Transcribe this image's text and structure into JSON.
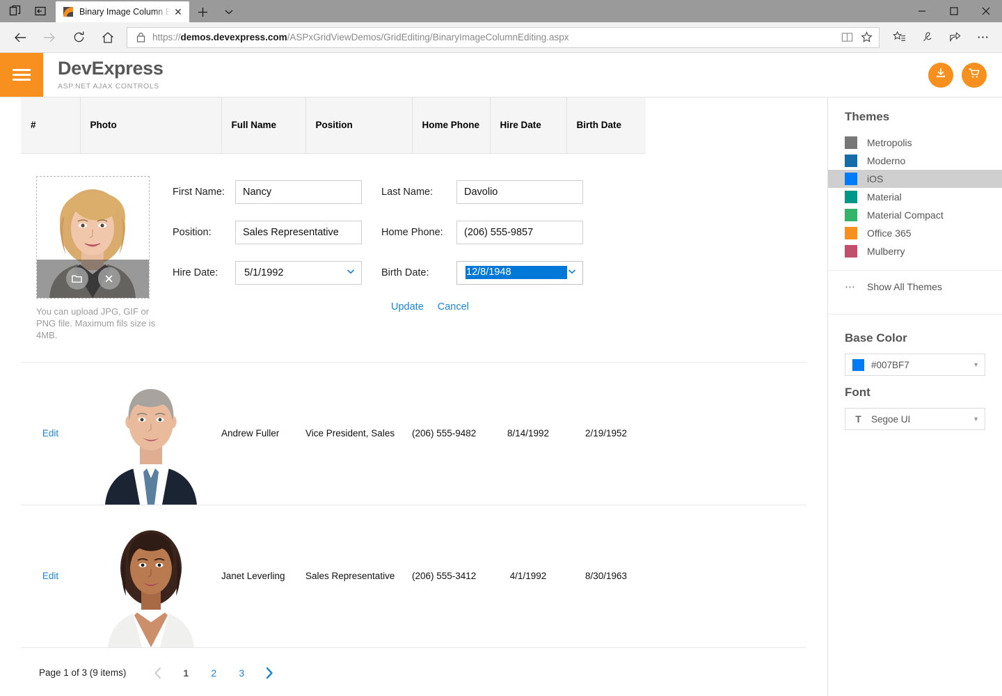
{
  "browser": {
    "tab": {
      "title": "Binary Image Column Editing",
      "favicon": "devexpress-logo-icon",
      "close_label": "✕"
    },
    "new_tab_label": "+",
    "tab_menu_label": "⌄",
    "window_controls": {
      "minimize": "—",
      "maximize": "□",
      "close": "✕"
    },
    "nav": {
      "back": "←",
      "forward": "→",
      "refresh": "⟳",
      "home": "home-icon"
    },
    "url": {
      "scheme": "https://",
      "domain": "demos.devexpress.com",
      "path": "/ASPxGridViewDemos/GridEditing/BinaryImageColumnEditing.aspx",
      "lock": "lock-icon"
    },
    "url_icons": {
      "reading_view": "book-icon",
      "favorite": "☆"
    },
    "toolbar_icons": {
      "favorites": "favorites-icon",
      "notes": "notes-icon",
      "share": "share-icon",
      "more": "•••"
    }
  },
  "app_header": {
    "menu_label": "hamburger-menu",
    "brand": "DevExpress",
    "subtitle": "ASP.NET AJAX CONTROLS",
    "actions": {
      "download": "download-icon",
      "cart": "cart-icon"
    },
    "accent": "#f7901e"
  },
  "grid": {
    "columns": [
      {
        "key": "num",
        "label": "#"
      },
      {
        "key": "photo",
        "label": "Photo"
      },
      {
        "key": "name",
        "label": "Full Name"
      },
      {
        "key": "pos",
        "label": "Position"
      },
      {
        "key": "phone",
        "label": "Home Phone"
      },
      {
        "key": "hire",
        "label": "Hire Date"
      },
      {
        "key": "birth",
        "label": "Birth Date"
      }
    ],
    "edit_form": {
      "upload": {
        "hint": "You can upload JPG, GIF or PNG file. Maximum fils size is 4MB.",
        "browse_icon": "folder-icon",
        "clear_icon": "close-circle-icon"
      },
      "first_name": {
        "label": "First Name:",
        "value": "Nancy"
      },
      "last_name": {
        "label": "Last Name:",
        "value": "Davolio"
      },
      "position": {
        "label": "Position:",
        "value": "Sales Representative"
      },
      "home_phone": {
        "label": "Home Phone:",
        "value": "(206) 555-9857"
      },
      "hire_date": {
        "label": "Hire Date:",
        "value": "5/1/1992"
      },
      "birth_date": {
        "label": "Birth Date:",
        "value": "12/8/1948",
        "selected": true
      },
      "update_label": "Update",
      "cancel_label": "Cancel"
    },
    "rows": [
      {
        "edit_label": "Edit",
        "name": "Andrew Fuller",
        "position": "Vice President, Sales",
        "phone": "(206) 555-9482",
        "hire": "8/14/1992",
        "birth": "2/19/1952"
      },
      {
        "edit_label": "Edit",
        "name": "Janet Leverling",
        "position": "Sales Representative",
        "phone": "(206) 555-3412",
        "hire": "4/1/1992",
        "birth": "8/30/1963"
      }
    ],
    "pager": {
      "info": "Page 1 of 3 (9 items)",
      "prev": "‹",
      "next": "›",
      "pages": [
        "1",
        "2",
        "3"
      ],
      "current": "1"
    }
  },
  "sidebar": {
    "themes_title": "Themes",
    "themes": [
      {
        "label": "Metropolis",
        "color": "#777777",
        "active": false
      },
      {
        "label": "Moderno",
        "color": "#176ba6",
        "active": false
      },
      {
        "label": "iOS",
        "color": "#007bf7",
        "active": true
      },
      {
        "label": "Material",
        "color": "#009688",
        "active": false
      },
      {
        "label": "Material Compact",
        "color": "#34b46a",
        "active": false
      },
      {
        "label": "Office 365",
        "color": "#f7901e",
        "active": false
      },
      {
        "label": "Mulberry",
        "color": "#c0506c",
        "active": false
      }
    ],
    "show_all": {
      "label": "Show All Themes",
      "icon": "ellipsis-icon"
    },
    "base_color": {
      "heading": "Base Color",
      "value": "#007BF7",
      "swatch": "#007bf7"
    },
    "font": {
      "heading": "Font",
      "value": "Segoe UI",
      "icon": "text-format-icon"
    }
  }
}
